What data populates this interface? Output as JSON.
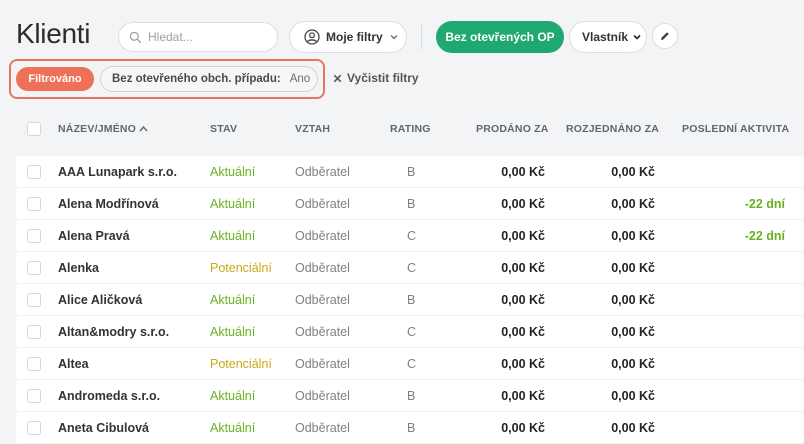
{
  "page": {
    "title": "Klienti"
  },
  "search": {
    "placeholder": "Hledat..."
  },
  "toolbar": {
    "my_filters_label": "Moje filtry",
    "no_open_deals_label": "Bez otevřených OP",
    "owner_label": "Vlastník"
  },
  "filters": {
    "filtered_label": "Filtrováno",
    "chip": {
      "name": "Bez otevřeného obch. případu:",
      "value": "Ano"
    },
    "clear_label": "Vyčistit filtry"
  },
  "colors": {
    "accent_green": "#1fa971",
    "filter_orange": "#ee7056",
    "status_current": "#6ab023",
    "status_potential": "#cfa714"
  },
  "table": {
    "columns": {
      "name": "NÁZEV/JMÉNO",
      "state": "STAV",
      "relation": "VZTAH",
      "rating": "RATING",
      "sold": "PRODÁNO ZA",
      "negotiated": "ROZJEDNÁNO ZA",
      "last_activity": "POSLEDNÍ AKTIVITA"
    },
    "sort_indicator": "^",
    "rows": [
      {
        "name": "AAA Lunapark s.r.o.",
        "state": "Aktuální",
        "state_kind": "current",
        "relation": "Odběratel",
        "rating": "B",
        "sold": "0,00 Kč",
        "negotiated": "0,00 Kč",
        "last_activity": ""
      },
      {
        "name": "Alena Modřínová",
        "state": "Aktuální",
        "state_kind": "current",
        "relation": "Odběratel",
        "rating": "B",
        "sold": "0,00 Kč",
        "negotiated": "0,00 Kč",
        "last_activity": "-22 dní"
      },
      {
        "name": "Alena Pravá",
        "state": "Aktuální",
        "state_kind": "current",
        "relation": "Odběratel",
        "rating": "C",
        "sold": "0,00 Kč",
        "negotiated": "0,00 Kč",
        "last_activity": "-22 dní"
      },
      {
        "name": "Alenka",
        "state": "Potenciální",
        "state_kind": "potential",
        "relation": "Odběratel",
        "rating": "C",
        "sold": "0,00 Kč",
        "negotiated": "0,00 Kč",
        "last_activity": ""
      },
      {
        "name": "Alice Aličková",
        "state": "Aktuální",
        "state_kind": "current",
        "relation": "Odběratel",
        "rating": "B",
        "sold": "0,00 Kč",
        "negotiated": "0,00 Kč",
        "last_activity": ""
      },
      {
        "name": "Altan&modry s.r.o.",
        "state": "Aktuální",
        "state_kind": "current",
        "relation": "Odběratel",
        "rating": "C",
        "sold": "0,00 Kč",
        "negotiated": "0,00 Kč",
        "last_activity": ""
      },
      {
        "name": "Altea",
        "state": "Potenciální",
        "state_kind": "potential",
        "relation": "Odběratel",
        "rating": "C",
        "sold": "0,00 Kč",
        "negotiated": "0,00 Kč",
        "last_activity": ""
      },
      {
        "name": "Andromeda s.r.o.",
        "state": "Aktuální",
        "state_kind": "current",
        "relation": "Odběratel",
        "rating": "B",
        "sold": "0,00 Kč",
        "negotiated": "0,00 Kč",
        "last_activity": ""
      },
      {
        "name": "Aneta Cibulová",
        "state": "Aktuální",
        "state_kind": "current",
        "relation": "Odběratel",
        "rating": "B",
        "sold": "0,00 Kč",
        "negotiated": "0,00 Kč",
        "last_activity": ""
      }
    ]
  }
}
